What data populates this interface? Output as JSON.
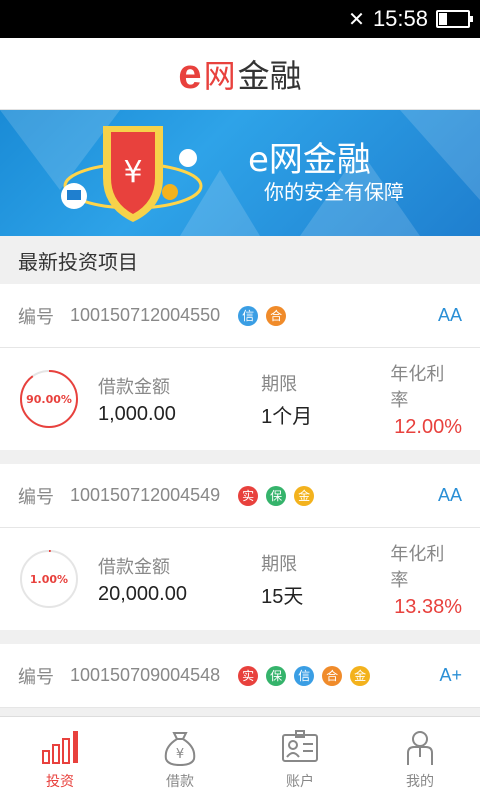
{
  "status": {
    "time": "15:58"
  },
  "header": {
    "logo_e": "e",
    "logo_wang": "网",
    "logo_rest": "金融"
  },
  "banner": {
    "title": "e网金融",
    "subtitle": "你的安全有保障"
  },
  "section_title": "最新投资项目",
  "labels": {
    "id": "编号",
    "amount": "借款金额",
    "term": "期限",
    "rate": "年化利率"
  },
  "projects": [
    {
      "id": "100150712004550",
      "tags": [
        {
          "text": "信",
          "color": "#3a9ee4"
        },
        {
          "text": "合",
          "color": "#f08b2a"
        }
      ],
      "rating": "AA",
      "progress_text": "90.00%",
      "progress": 0.9,
      "amount": "1,000.00",
      "term": "1个月",
      "rate": "12.00%"
    },
    {
      "id": "100150712004549",
      "tags": [
        {
          "text": "实",
          "color": "#e8413d"
        },
        {
          "text": "保",
          "color": "#35b36b"
        },
        {
          "text": "金",
          "color": "#f3b21d"
        }
      ],
      "rating": "AA",
      "progress_text": "1.00%",
      "progress": 0.01,
      "amount": "20,000.00",
      "term": "15天",
      "rate": "13.38%"
    },
    {
      "id": "100150709004548",
      "tags": [
        {
          "text": "实",
          "color": "#e8413d"
        },
        {
          "text": "保",
          "color": "#35b36b"
        },
        {
          "text": "信",
          "color": "#3a9ee4"
        },
        {
          "text": "合",
          "color": "#f08b2a"
        },
        {
          "text": "金",
          "color": "#f3b21d"
        }
      ],
      "rating": "A+"
    }
  ],
  "tabs": [
    {
      "label": "投资",
      "icon": "bar-chart-icon",
      "active": true
    },
    {
      "label": "借款",
      "icon": "money-bag-icon",
      "active": false
    },
    {
      "label": "账户",
      "icon": "account-card-icon",
      "active": false
    },
    {
      "label": "我的",
      "icon": "person-icon",
      "active": false
    }
  ],
  "colors": {
    "accent": "#e8413d",
    "blue": "#2a8fd6"
  }
}
